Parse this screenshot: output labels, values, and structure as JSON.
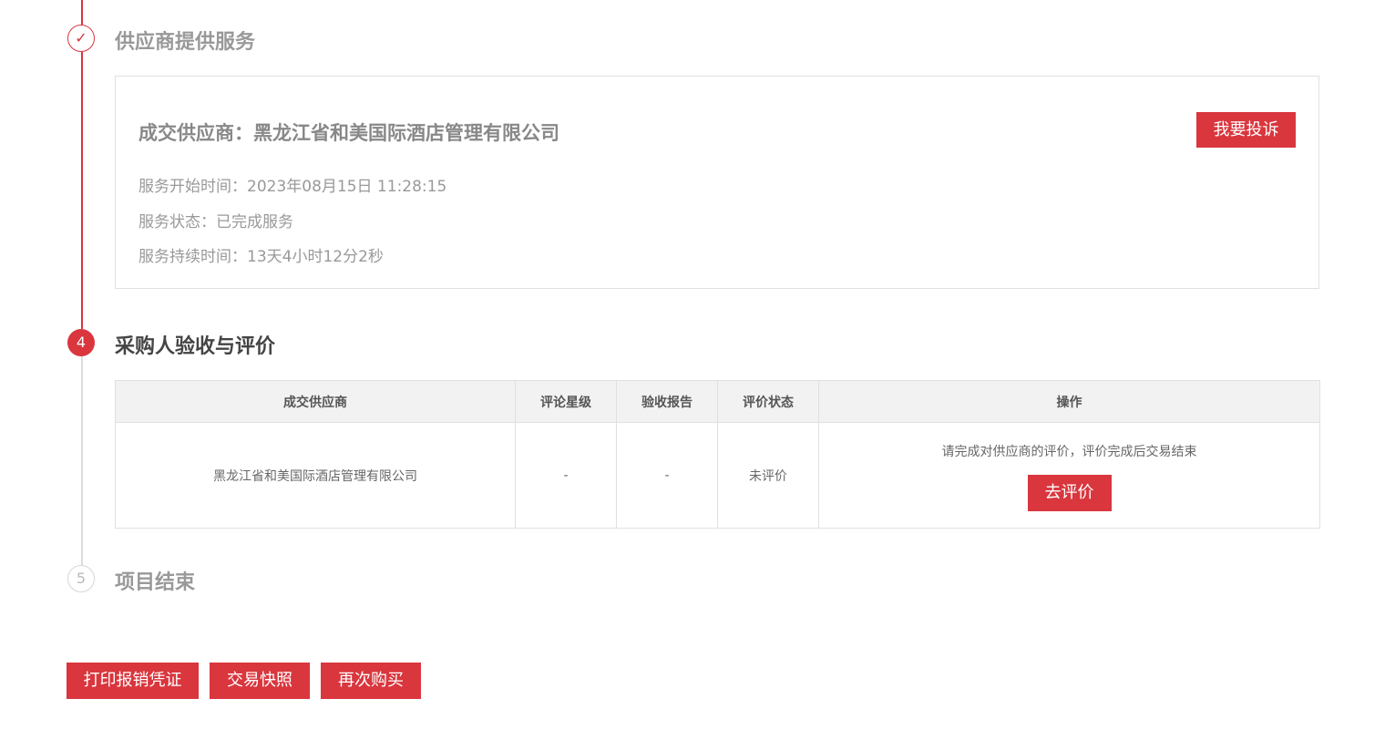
{
  "steps": [
    {
      "number": "✓",
      "title": "供应商提供服务",
      "state": "done"
    },
    {
      "number": "4",
      "title": "采购人验收与评价",
      "state": "active"
    },
    {
      "number": "5",
      "title": "项目结束",
      "state": "todo"
    }
  ],
  "service_card": {
    "supplier_label": "成交供应商：黑龙江省和美国际酒店管理有限公司",
    "complain_button": "我要投诉",
    "start_time": "服务开始时间：2023年08月15日 11:28:15",
    "status": "服务状态：已完成服务",
    "duration": "服务持续时间：13天4小时12分2秒"
  },
  "eval_table": {
    "headers": [
      "成交供应商",
      "评论星级",
      "验收报告",
      "评价状态",
      "操作"
    ],
    "row": {
      "supplier": "黑龙江省和美国际酒店管理有限公司",
      "rating": "-",
      "report": "-",
      "status": "未评价",
      "hint": "请完成对供应商的评价，评价完成后交易结束",
      "action_button": "去评价"
    }
  },
  "footer_buttons": [
    "打印报销凭证",
    "交易快照",
    "再次购买"
  ],
  "colors": {
    "accent": "#d9363e",
    "border": "#e0e0e0",
    "header_bg": "#f2f2f2"
  }
}
